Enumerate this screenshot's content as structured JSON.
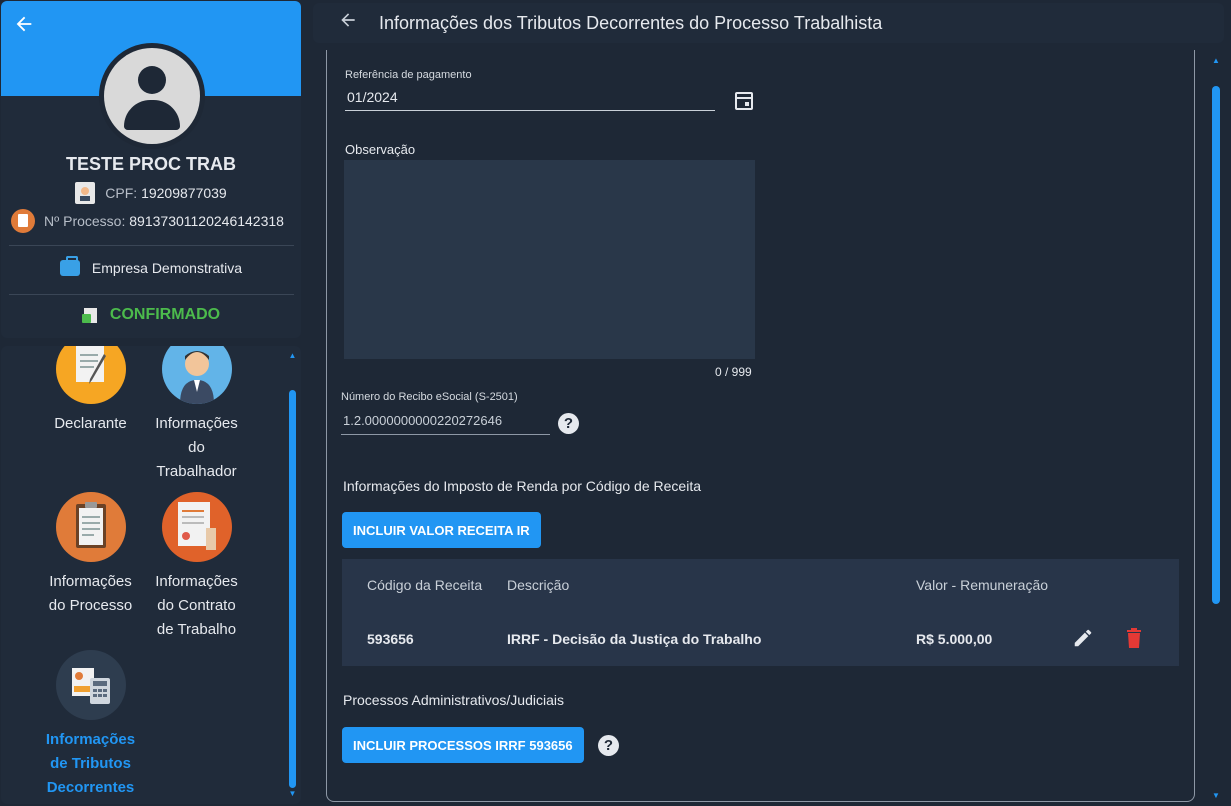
{
  "profile": {
    "name": "TESTE PROC TRAB",
    "cpf_label": "CPF:",
    "cpf_value": "19209877039",
    "process_label": "Nº Processo:",
    "process_value": "89137301120246142318",
    "company": "Empresa Demonstrativa",
    "status": "CONFIRMADO"
  },
  "nav": {
    "items": [
      {
        "label": "Declarante"
      },
      {
        "label": "Informações do Trabalhador"
      },
      {
        "label": "Informações do Processo"
      },
      {
        "label": "Informações do Contrato de Trabalho"
      },
      {
        "label": "Informações de Tributos Decorrentes"
      }
    ]
  },
  "header": {
    "title": "Informações dos Tributos Decorrentes do Processo Trabalhista"
  },
  "form": {
    "ref_label": "Referência de pagamento",
    "ref_value": "01/2024",
    "obs_label": "Observação",
    "obs_value": "",
    "obs_counter": "0 / 999",
    "recibo_label": "Número do Recibo eSocial (S-2501)",
    "recibo_value": "1.2.0000000000220272646"
  },
  "ir_section": {
    "title": "Informações do Imposto de Renda por Código de Receita",
    "button": "INCLUIR VALOR RECEITA IR",
    "columns": [
      "Código da Receita",
      "Descrição",
      "Valor - Remuneração"
    ],
    "rows": [
      {
        "codigo": "593656",
        "descricao": "IRRF - Decisão da Justiça do Trabalho",
        "valor": "R$ 5.000,00"
      }
    ]
  },
  "proc_section": {
    "title": "Processos Administrativos/Judiciais",
    "button": "INCLUIR PROCESSOS IRRF 593656"
  },
  "colors": {
    "accent": "#2196f3",
    "status_green": "#4cbb4c",
    "delete_red": "#e53935"
  },
  "icons": {
    "back": "arrow-left-icon",
    "calendar": "calendar-icon",
    "help": "help-circle-icon",
    "edit": "pencil-icon",
    "delete": "trash-icon"
  }
}
